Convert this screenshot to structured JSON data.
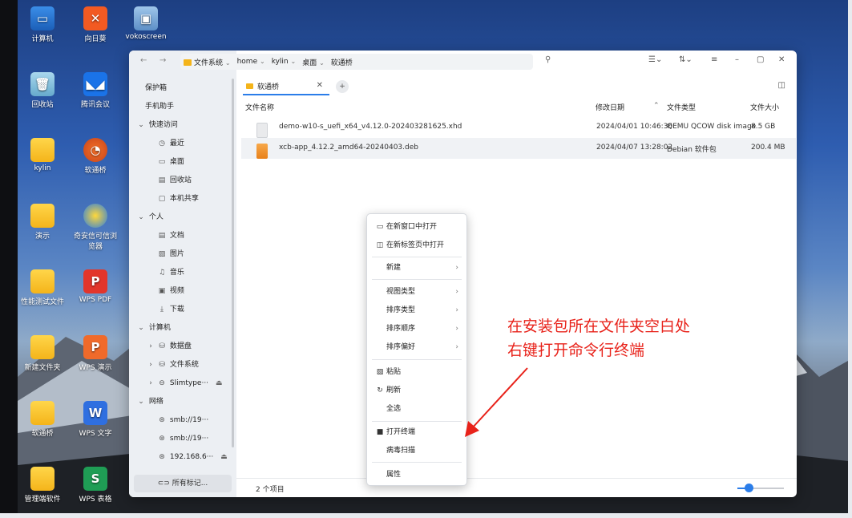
{
  "desktop": {
    "icons": [
      {
        "label": "计算机"
      },
      {
        "label": "向日葵"
      },
      {
        "label": "vokoscreen"
      },
      {
        "label": "回收站"
      },
      {
        "label": "腾讯会议"
      },
      {
        "label": "kylin"
      },
      {
        "label": "软通桥"
      },
      {
        "label": "演示"
      },
      {
        "label": "奇安信可信浏览器"
      },
      {
        "label": "性能测试文件"
      },
      {
        "label": "WPS PDF"
      },
      {
        "label": "新建文件夹"
      },
      {
        "label": "WPS 演示"
      },
      {
        "label": "软通桥"
      },
      {
        "label": "WPS 文字"
      },
      {
        "label": "管理端软件"
      },
      {
        "label": "WPS 表格"
      }
    ]
  },
  "window": {
    "breadcrumbs": [
      "文件系统",
      "home",
      "kylin",
      "桌面",
      "软通桥"
    ],
    "sidebar": {
      "items": [
        {
          "label": "保护箱",
          "icon": ""
        },
        {
          "label": "手机助手",
          "icon": ""
        },
        {
          "label": "快速访问",
          "icon": "chevron-down-icon"
        },
        {
          "label": "最近",
          "icon": "clock-icon"
        },
        {
          "label": "桌面",
          "icon": "monitor-icon"
        },
        {
          "label": "回收站",
          "icon": "trash-icon"
        },
        {
          "label": "本机共享",
          "icon": "share-folder-icon"
        },
        {
          "label": "个人",
          "icon": "chevron-down-icon"
        },
        {
          "label": "文档",
          "icon": "document-icon"
        },
        {
          "label": "图片",
          "icon": "image-icon"
        },
        {
          "label": "音乐",
          "icon": "music-icon"
        },
        {
          "label": "视频",
          "icon": "video-icon"
        },
        {
          "label": "下载",
          "icon": "download-icon"
        },
        {
          "label": "计算机",
          "icon": "chevron-down-icon"
        },
        {
          "label": "数据盘",
          "icon": "drive-icon"
        },
        {
          "label": "文件系统",
          "icon": "drive-icon"
        },
        {
          "label": "Slimtype···",
          "icon": "drive-icon"
        },
        {
          "label": "网络",
          "icon": "chevron-down-icon"
        },
        {
          "label": "smb://19···",
          "icon": "network-icon"
        },
        {
          "label": "smb://19···",
          "icon": "network-icon"
        },
        {
          "label": "192.168.6···",
          "icon": "network-icon"
        }
      ],
      "bottom_label": "所有标记..."
    },
    "tab": {
      "label": "软通桥"
    },
    "columns": {
      "name": "文件名称",
      "date": "修改日期",
      "type": "文件类型",
      "size": "文件大小"
    },
    "files": [
      {
        "name": "demo-w10-s_uefi_x64_v4.12.0-202403281625.xhd",
        "date": "2024/04/01 10:46:36",
        "type": "QEMU QCOW disk image",
        "size": "8.5 GB"
      },
      {
        "name": "xcb-app_4.12.2_amd64-20240403.deb",
        "date": "2024/04/07 13:28:02",
        "type": "Debian 软件包",
        "size": "200.4 MB"
      }
    ],
    "status": {
      "count": "2 个项目"
    },
    "zoom_level": 0.25
  },
  "context_menu": {
    "items": [
      {
        "label": "在新窗口中打开",
        "icon": "window-icon"
      },
      {
        "label": "在新标签页中打开",
        "icon": "tab-icon"
      },
      {
        "label": "新建",
        "submenu": true
      },
      {
        "label": "视图类型",
        "submenu": true
      },
      {
        "label": "排序类型",
        "submenu": true
      },
      {
        "label": "排序顺序",
        "submenu": true
      },
      {
        "label": "排序偏好",
        "submenu": true
      },
      {
        "label": "粘贴",
        "icon": "paste-icon"
      },
      {
        "label": "刷新",
        "icon": "refresh-icon"
      },
      {
        "label": "全选"
      },
      {
        "label": "打开终端",
        "icon": "terminal-icon"
      },
      {
        "label": "病毒扫描"
      },
      {
        "label": "属性"
      }
    ]
  },
  "annotation": {
    "line1": "在安装包所在文件夹空白处",
    "line2": "右键打开命令行终端",
    "color": "#e8221a"
  }
}
